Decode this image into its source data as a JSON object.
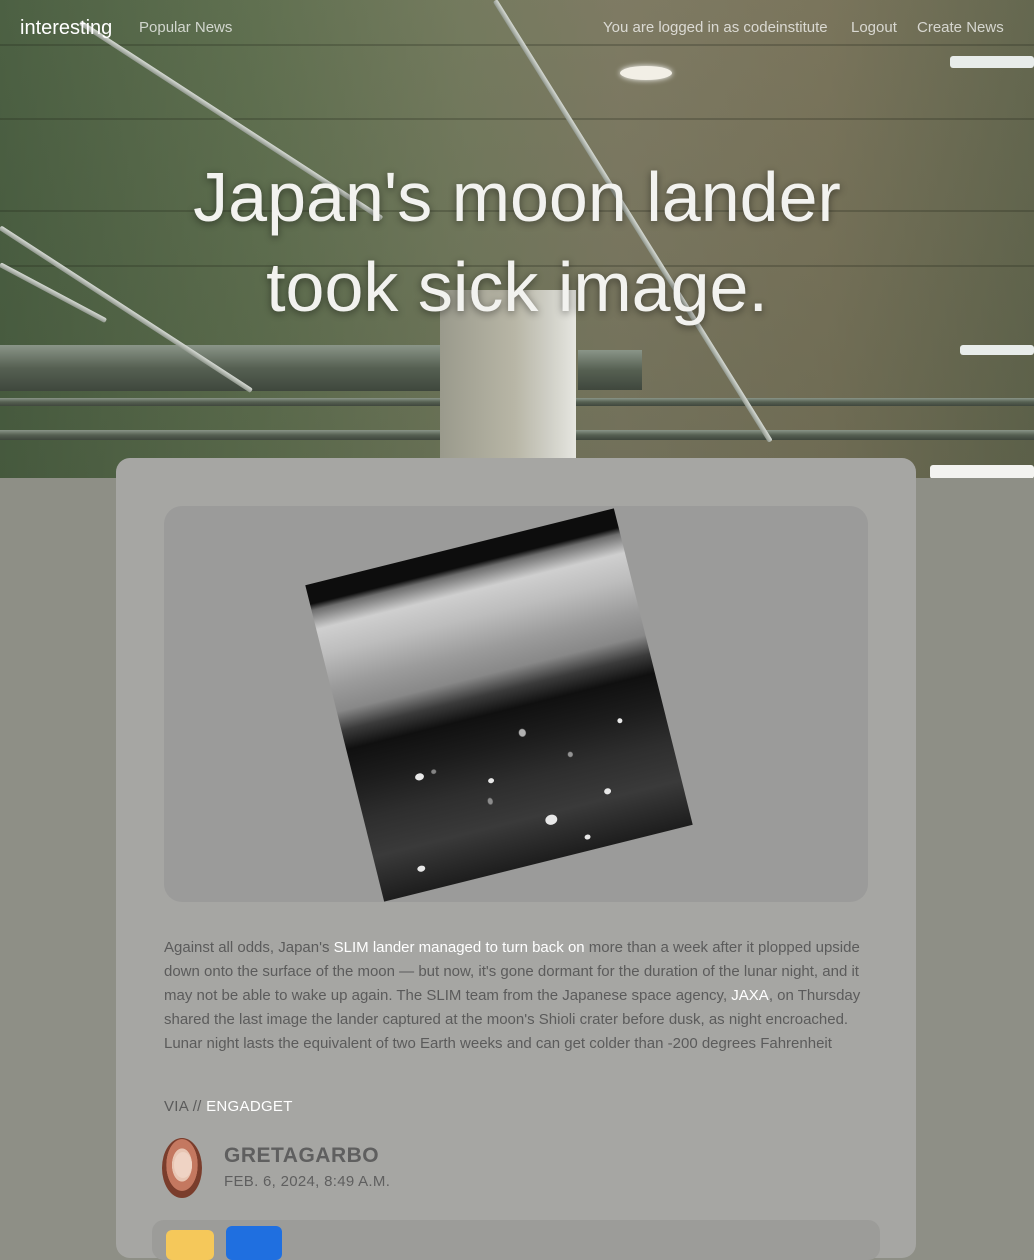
{
  "navbar": {
    "brand": "interesting",
    "popular_news": "Popular News",
    "logged_in_text": "You are logged in as codeinstitute",
    "logout": "Logout",
    "create_news": "Create News"
  },
  "hero": {
    "title_line1": "Japan's moon lander",
    "title_line2": "took sick image."
  },
  "article": {
    "body_part1": "Against all odds, Japan's ",
    "link1": "SLIM lander managed to turn back on",
    "body_part2": " more than a week after it plopped upside down onto the surface of the moon — but now, it's gone dormant for the duration of the lunar night, and it may not be able to wake up again. The SLIM team from the Japanese space agency, ",
    "link2": "JAXA",
    "body_part3": ", on Thursday shared the last image the lander captured at the moon's Shioli crater before dusk, as night encroached. Lunar night lasts the equivalent of two Earth weeks and can get colder than -200 degrees Fahrenheit",
    "via_label": "VIA //",
    "via_source": "ENGADGET"
  },
  "author": {
    "name": "GRETAGARBO",
    "date": "FEB. 6, 2024, 8:49 A.M."
  },
  "colors": {
    "page_bg": "#8e8f86",
    "card_bg": "#a6a6a3",
    "link": "#ffffff",
    "btn_yellow": "#f5c85a",
    "btn_blue": "#1f6fe0"
  }
}
